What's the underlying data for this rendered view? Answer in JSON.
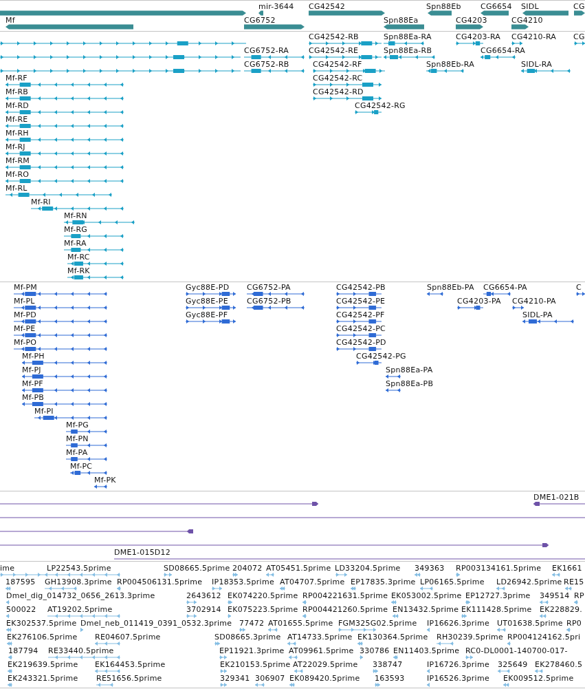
{
  "tracks": [
    {
      "kind": "gene",
      "features": [
        {
          "forward": true
        },
        {
          "label": "mir-3644",
          "forward": false
        },
        {
          "label": "CG42542",
          "forward": true
        },
        {
          "label": "Spn88Eb",
          "forward": false
        },
        {
          "label": "CG6654",
          "forward": false
        },
        {
          "label": "SIDL",
          "forward": false
        },
        {
          "label": "CG",
          "forward": true
        },
        {
          "label": "Mf",
          "forward": false
        },
        {
          "label": "CG6752",
          "forward": true
        },
        {
          "label": "Spn88Ea",
          "forward": false
        },
        {
          "label": "CG4203",
          "forward": true
        },
        {
          "label": "CG4210",
          "forward": true
        }
      ]
    },
    {
      "kind": "mrna",
      "features": [
        {
          "forward": true
        },
        {
          "label": "CG42542-RB",
          "forward": true
        },
        {
          "label": "Spn88Ea-RA",
          "forward": false
        },
        {
          "label": "CG4203-RA",
          "forward": true
        },
        {
          "label": "CG4210-RA",
          "forward": true
        },
        {
          "label": "CG",
          "forward": true
        },
        {
          "forward": true
        },
        {
          "label": "CG6752-RA",
          "forward": false
        },
        {
          "label": "CG42542-RE",
          "forward": true
        },
        {
          "label": "Spn88Ea-RB",
          "forward": false
        },
        {
          "label": "CG6654-RA",
          "forward": false
        },
        {
          "forward": true
        },
        {
          "label": "CG6752-RB",
          "forward": false
        },
        {
          "label": "CG42542-RF",
          "forward": true
        },
        {
          "label": "Spn88Eb-RA",
          "forward": false
        },
        {
          "label": "SIDL-RA",
          "forward": false
        },
        {
          "label": "Mf-RF",
          "forward": false
        },
        {
          "label": "CG42542-RC",
          "forward": true
        },
        {
          "label": "Mf-RB",
          "forward": false
        },
        {
          "label": "CG42542-RD",
          "forward": true
        },
        {
          "label": "Mf-RD",
          "forward": false
        },
        {
          "label": "CG42542-RG",
          "forward": true
        },
        {
          "label": "Mf-RE",
          "forward": false
        },
        {
          "label": "Mf-RH",
          "forward": false
        },
        {
          "label": "Mf-RJ",
          "forward": false
        },
        {
          "label": "Mf-RM",
          "forward": false
        },
        {
          "label": "Mf-RO",
          "forward": false
        },
        {
          "label": "Mf-RL",
          "forward": false
        },
        {
          "label": "Mf-RI",
          "forward": false
        },
        {
          "label": "Mf-RN",
          "forward": false
        },
        {
          "label": "Mf-RG",
          "forward": false
        },
        {
          "label": "Mf-RA",
          "forward": false
        },
        {
          "label": "Mf-RC",
          "forward": false
        },
        {
          "label": "Mf-RK",
          "forward": false
        }
      ]
    },
    {
      "kind": "cds",
      "features": [
        {
          "label": "Mf-PM",
          "forward": false
        },
        {
          "label": "Gyc88E-PD",
          "forward": true
        },
        {
          "label": "CG6752-PA",
          "forward": false
        },
        {
          "label": "CG42542-PB",
          "forward": true
        },
        {
          "label": "Spn88Eb-PA",
          "forward": false
        },
        {
          "label": "CG6654-PA",
          "forward": false
        },
        {
          "label": "C",
          "forward": true
        },
        {
          "label": "Mf-PL",
          "forward": false
        },
        {
          "label": "Gyc88E-PE",
          "forward": true
        },
        {
          "label": "CG6752-PB",
          "forward": false
        },
        {
          "label": "CG42542-PE",
          "forward": true
        },
        {
          "label": "CG4203-PA",
          "forward": true
        },
        {
          "label": "CG4210-PA",
          "forward": true
        },
        {
          "label": "Mf-PD",
          "forward": false
        },
        {
          "label": "Gyc88E-PF",
          "forward": true
        },
        {
          "label": "CG42542-PF",
          "forward": true
        },
        {
          "label": "SIDL-PA",
          "forward": false
        },
        {
          "label": "Mf-PE",
          "forward": false
        },
        {
          "label": "CG42542-PC",
          "forward": true
        },
        {
          "label": "Mf-PO",
          "forward": false
        },
        {
          "label": "CG42542-PD",
          "forward": true
        },
        {
          "label": "Mf-PH",
          "forward": false
        },
        {
          "label": "CG42542-PG",
          "forward": true
        },
        {
          "label": "Mf-PJ",
          "forward": false
        },
        {
          "label": "Spn88Ea-PA",
          "forward": false
        },
        {
          "label": "Mf-PF",
          "forward": false
        },
        {
          "label": "Spn88Ea-PB",
          "forward": false
        },
        {
          "label": "Mf-PB",
          "forward": false
        },
        {
          "label": "Mf-PI",
          "forward": false
        },
        {
          "label": "Mf-PG",
          "forward": false
        },
        {
          "label": "Mf-PN",
          "forward": false
        },
        {
          "label": "Mf-PA",
          "forward": false
        },
        {
          "label": "Mf-PC",
          "forward": false
        },
        {
          "label": "Mf-PK",
          "forward": false
        }
      ]
    },
    {
      "kind": "match",
      "features": [
        {
          "kind": "arrow",
          "forward": true
        },
        {
          "kind": "arrow",
          "label": "DME1-021B",
          "forward": false
        },
        {
          "kind": "line"
        },
        {
          "kind": "arrow",
          "forward": false
        },
        {
          "kind": "arrow",
          "forward": true
        },
        {
          "kind": "arrow",
          "label": "DME1-015D12",
          "forward": true
        }
      ]
    },
    {
      "kind": "est",
      "features": [
        {
          "label": "ime",
          "forward": true
        },
        {
          "label": "LP22543.5prime",
          "forward": false
        },
        {
          "label": "SD08665.5prime",
          "forward": true
        },
        {
          "label": "204072",
          "forward": true
        },
        {
          "label": "AT05451.5prime",
          "forward": false
        },
        {
          "label": "LD33204.5prime",
          "forward": true
        },
        {
          "label": "349363",
          "forward": false
        },
        {
          "label": "RP003134161.5prime",
          "forward": true
        },
        {
          "label": "EK1661",
          "forward": false
        },
        {
          "label": "187595",
          "forward": false
        },
        {
          "label": "GH13908.3prime",
          "forward": false
        },
        {
          "label": "RP004506131.5prime",
          "forward": false
        },
        {
          "label": "IP18353.5prime",
          "forward": true
        },
        {
          "label": "AT04707.5prime",
          "forward": false
        },
        {
          "label": "EP17835.3prime",
          "forward": false
        },
        {
          "label": "LP06165.5prime",
          "forward": false
        },
        {
          "label": "LD26942.5prime",
          "forward": false
        },
        {
          "label": "RE15",
          "forward": false
        },
        {
          "label": "Dmel_dig_014732_0656_2613.3prime",
          "forward": false
        },
        {
          "label": "2643612",
          "forward": true
        },
        {
          "label": "EK074220.5prime",
          "forward": true
        },
        {
          "label": "RP004221631.5prime",
          "forward": false
        },
        {
          "label": "EK053002.5prime",
          "forward": false
        },
        {
          "label": "EP12727.3prime",
          "forward": true
        },
        {
          "label": "349514",
          "forward": false
        },
        {
          "label": "RP",
          "forward": false
        },
        {
          "label": "500022",
          "forward": false
        },
        {
          "label": "AT19202.5prime",
          "forward": false
        },
        {
          "label": "3702914",
          "forward": true
        },
        {
          "label": "EK075223.5prime",
          "forward": true
        },
        {
          "label": "RP004421260.5prime",
          "forward": false
        },
        {
          "label": "EN13432.5prime",
          "forward": false
        },
        {
          "label": "EK111428.5prime",
          "forward": true
        },
        {
          "label": "EK228829.",
          "forward": false
        },
        {
          "label": "EK302537.5prime",
          "forward": false
        },
        {
          "label": "Dmel_neb_011419_0391_0532.3prime",
          "forward": true
        },
        {
          "label": "77472",
          "forward": true
        },
        {
          "label": "AT01655.5prime",
          "forward": false
        },
        {
          "label": "FGM325G02.5prime",
          "forward": true
        },
        {
          "label": "IP16626.3prime",
          "forward": false
        },
        {
          "label": "UT01638.5prime",
          "forward": false
        },
        {
          "label": "RP0",
          "forward": false
        },
        {
          "label": "EK276106.5prime",
          "forward": false
        },
        {
          "label": "RE04607.5prime",
          "forward": false
        },
        {
          "label": "SD08665.3prime",
          "forward": true
        },
        {
          "label": "AT14733.5prime",
          "forward": false
        },
        {
          "label": "EK130364.5prime",
          "forward": false
        },
        {
          "label": "RH30239.5prime",
          "forward": false
        },
        {
          "label": "RP004124162.5pri",
          "forward": false
        },
        {
          "label": "187794",
          "forward": false
        },
        {
          "label": "RE33440.5prime",
          "forward": false
        },
        {
          "label": "EP11921.3prime",
          "forward": true
        },
        {
          "label": "AT09961.5prime",
          "forward": false
        },
        {
          "label": "330786",
          "forward": true
        },
        {
          "label": "EN11403.5prime",
          "forward": false
        },
        {
          "label": "RC0-DL0001-140700-017-",
          "forward": true
        },
        {
          "label": "EK219639.5prime",
          "forward": false
        },
        {
          "label": "EK164453.5prime",
          "forward": false
        },
        {
          "label": "EK210153.5prime",
          "forward": true
        },
        {
          "label": "AT22029.5prime",
          "forward": false
        },
        {
          "label": "338747",
          "forward": true
        },
        {
          "label": "IP16726.3prime",
          "forward": false
        },
        {
          "label": "325649",
          "forward": false
        },
        {
          "label": "EK278460.5",
          "forward": false
        },
        {
          "label": "EK243321.5prime",
          "forward": false
        },
        {
          "label": "RE51656.5prime",
          "forward": false
        },
        {
          "label": "329341",
          "forward": true
        },
        {
          "label": "306907",
          "forward": false
        },
        {
          "label": "EK089420.5prime",
          "forward": false
        },
        {
          "label": "163593",
          "forward": true
        },
        {
          "label": "IP16526.3prime",
          "forward": false
        },
        {
          "label": "EK009512.5prime",
          "forward": false
        }
      ]
    }
  ]
}
